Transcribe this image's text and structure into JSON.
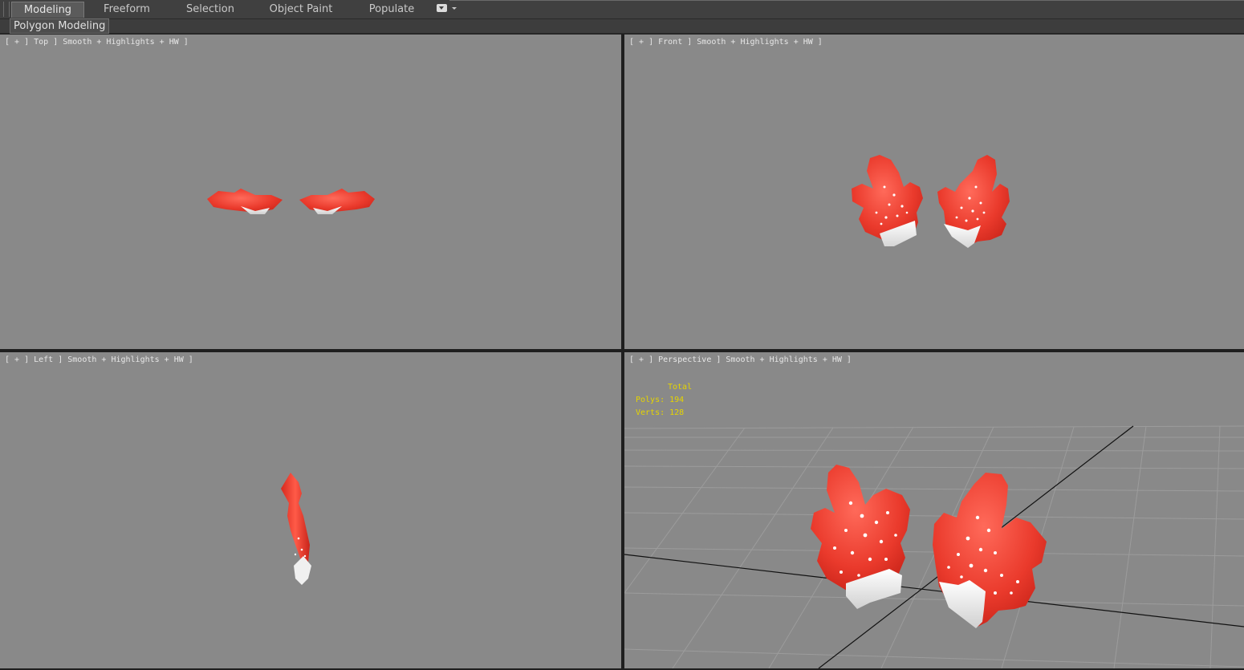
{
  "ribbon": {
    "tabs": [
      {
        "label": "Modeling",
        "active": true
      },
      {
        "label": "Freeform",
        "active": false
      },
      {
        "label": "Selection",
        "active": false
      },
      {
        "label": "Object Paint",
        "active": false
      },
      {
        "label": "Populate",
        "active": false
      }
    ],
    "panel_label": "Polygon Modeling"
  },
  "viewports": {
    "top": {
      "label": "[ + ] Top ] Smooth + Highlights + HW ]"
    },
    "front": {
      "label": "[ + ] Front ] Smooth + Highlights + HW ]"
    },
    "left": {
      "label": "[ + ] Left ] Smooth + Highlights + HW ]"
    },
    "perspective": {
      "label": "[ + ] Perspective ] Smooth + Highlights + HW ]"
    }
  },
  "stats": {
    "total_label": "Total",
    "polys": "Polys: 194",
    "verts": "Verts: 128"
  },
  "colors": {
    "viewport_bg": "#898989",
    "model_red": "#e8352b",
    "model_white": "#f2f2f2",
    "stats_yellow": "#e5d400",
    "active_tab": "#5b5b5b"
  }
}
